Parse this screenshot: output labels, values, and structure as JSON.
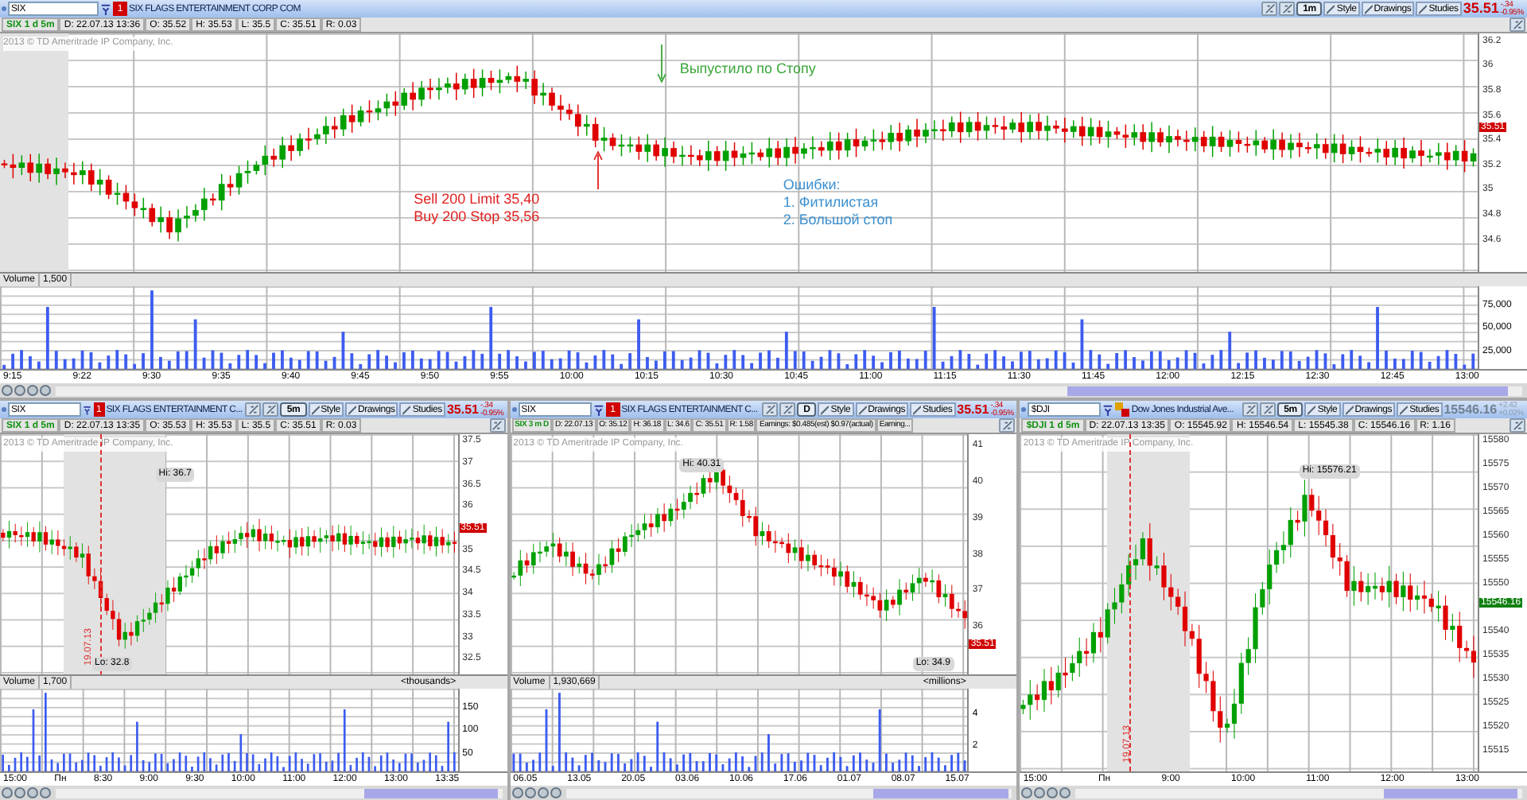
{
  "main": {
    "symbol": "SIX",
    "link_badge": "1",
    "company": "SIX FLAGS ENTERTAINMENT CORP COM",
    "period": "1m",
    "tools": [
      "Style",
      "Drawings",
      "Studies"
    ],
    "price": "35.51",
    "change": "-.34",
    "change_pct": "-0.95%",
    "info": [
      "SIX 1 d 5m",
      "D: 22.07.13 13:36",
      "O: 35.52",
      "H: 35.53",
      "L: 35.5",
      "C: 35.51",
      "R: 0.03"
    ],
    "copyright": "2013 © TD Ameritrade IP Company, Inc.",
    "price_ticks": [
      "36.2",
      "36",
      "35.8",
      "35.6",
      "35.4",
      "35.2",
      "35",
      "34.8",
      "34.6"
    ],
    "price_marker": "35.51",
    "volume_label": "Volume",
    "volume_value": "1,500",
    "volume_ticks": [
      "75,000",
      "50,000",
      "25,000"
    ],
    "time_labels": [
      "9:15",
      "9:22",
      "9:30",
      "9:35",
      "9:40",
      "9:45",
      "9:50",
      "9:55",
      "10:00",
      "10:15",
      "10:30",
      "10:45",
      "11:00",
      "11:15",
      "11:30",
      "11:45",
      "12:00",
      "12:15",
      "12:30",
      "12:45",
      "13:00"
    ],
    "annotations": [
      {
        "lines": [
          "Выпустило по Стопу"
        ],
        "color": "#3aa63a"
      },
      {
        "lines": [
          "Sell 200 Limit 35,40",
          "Buy 200 Stop 35,56"
        ],
        "color": "#e02020"
      },
      {
        "lines": [
          "Ошибки:",
          "1. Фитилистая",
          "2. Большой стоп"
        ],
        "color": "#3a8fd0"
      }
    ]
  },
  "panels": [
    {
      "symbol": "SIX",
      "link_badge": "1",
      "company": "SIX FLAGS ENTERTAINMENT C...",
      "period": "5m",
      "tools": [
        "Style",
        "Drawings",
        "Studies"
      ],
      "price": "35.51",
      "change": "-.34",
      "change_pct": "-0.95%",
      "info": [
        "SIX 1 d 5m",
        "D: 22.07.13 13:35",
        "O: 35.53",
        "H: 35.53",
        "L: 35.5",
        "C: 35.51",
        "R: 0.03"
      ],
      "copyright": "2013 © TD Ameritrade IP Company, Inc.",
      "price_ticks": [
        "37.5",
        "37",
        "36.5",
        "36",
        "35",
        "34.5",
        "34",
        "33.5",
        "33",
        "32.5"
      ],
      "price_marker": "35.51",
      "hi_label": "Hi: 36.7",
      "lo_label": "Lo: 32.8",
      "date_marker": "19.07.13",
      "volume_label": "Volume",
      "volume_value": "1,700",
      "volume_unit": "<thousands>",
      "volume_ticks": [
        "150",
        "100",
        "50"
      ],
      "time_labels": [
        "15:00",
        "Пн",
        "8:30",
        "9:00",
        "9:30",
        "10:00",
        "11:00",
        "12:00",
        "13:00",
        "13:35"
      ]
    },
    {
      "symbol": "SIX",
      "link_badge": "1",
      "company": "SIX FLAGS ENTERTAINMENT C...",
      "period": "D",
      "tools": [
        "Style",
        "Drawings",
        "Studies"
      ],
      "price": "35.51",
      "change": "-.34",
      "change_pct": "-0.95%",
      "info": [
        "SIX 3 m D",
        "D: 22.07.13",
        "O: 35.12",
        "H: 36.18",
        "L: 34.6",
        "C: 35.51",
        "R: 1.58",
        "Earnings: $0.485(est) $0.97(actual)",
        "Earning..."
      ],
      "copyright": "2013 © TD Ameritrade IP Company, Inc.",
      "price_ticks": [
        "41",
        "40",
        "39",
        "38",
        "37",
        "36"
      ],
      "price_marker": "35.51",
      "hi_label": "Hi: 40.31",
      "lo_label": "Lo: 34.9",
      "volume_label": "Volume",
      "volume_value": "1,930,669",
      "volume_unit": "<millions>",
      "volume_ticks": [
        "4",
        "2"
      ],
      "time_labels": [
        "06.05",
        "13.05",
        "20.05",
        "03.06",
        "10.06",
        "17.06",
        "01.07",
        "08.07",
        "15.07"
      ]
    },
    {
      "symbol": "$DJI",
      "company": "Dow Jones Industrial Ave...",
      "period": "5m",
      "tools": [
        "Style",
        "Drawings",
        "Studies"
      ],
      "price": "15546.16",
      "change": "+2.42",
      "change_pct": "+0.02%",
      "info": [
        "$DJI 1 d 5m",
        "D: 22.07.13 13:35",
        "O: 15545.92",
        "H: 15546.54",
        "L: 15545.38",
        "C: 15546.16",
        "R: 1.16"
      ],
      "copyright": "2013 © TD Ameritrade IP Company, Inc.",
      "price_ticks": [
        "15580",
        "15575",
        "15570",
        "15565",
        "15560",
        "15555",
        "15550",
        "15540",
        "15535",
        "15530",
        "15525",
        "15520",
        "15515"
      ],
      "price_marker": "15546.16",
      "hi_label": "Hi: 15576.21",
      "date_marker": "19.07.13",
      "time_labels": [
        "15:00",
        "Пн",
        "9:00",
        "10:00",
        "11:00",
        "12:00",
        "13:00"
      ]
    }
  ]
}
